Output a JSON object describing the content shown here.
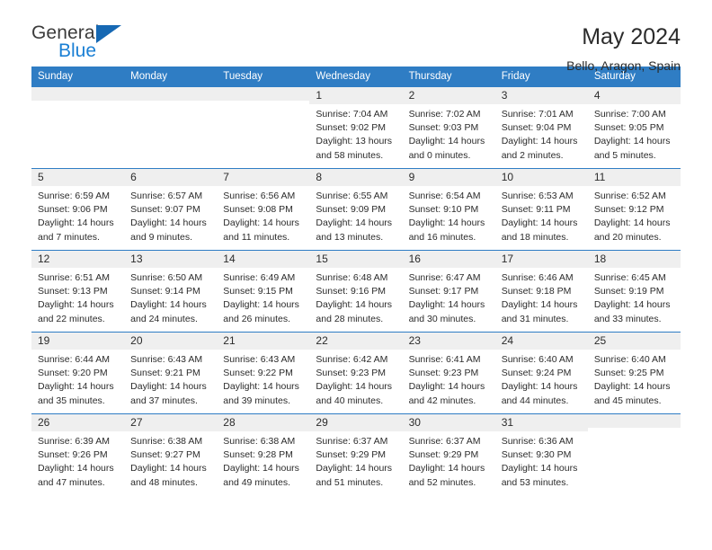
{
  "brand": {
    "name_top": "General",
    "name_bottom": "Blue",
    "accent_color": "#1668b3",
    "blue_text_color": "#1a7fd4"
  },
  "header": {
    "title": "May 2024",
    "subtitle": "Bello, Aragon, Spain"
  },
  "theme": {
    "header_row_bg": "#2f7dc4",
    "daynum_band_bg": "#efefef",
    "grid_line": "#2f7dc4",
    "text": "#2b2b2b"
  },
  "weekdays": [
    "Sunday",
    "Monday",
    "Tuesday",
    "Wednesday",
    "Thursday",
    "Friday",
    "Saturday"
  ],
  "labels": {
    "sunrise_prefix": "Sunrise: ",
    "sunset_prefix": "Sunset: ",
    "daylight_prefix": "Daylight: "
  },
  "weeks": [
    [
      {
        "day": "",
        "empty": true
      },
      {
        "day": "",
        "empty": true
      },
      {
        "day": "",
        "empty": true
      },
      {
        "day": "1",
        "sunrise": "Sunrise: 7:04 AM",
        "sunset": "Sunset: 9:02 PM",
        "daylight": "Daylight: 13 hours and 58 minutes."
      },
      {
        "day": "2",
        "sunrise": "Sunrise: 7:02 AM",
        "sunset": "Sunset: 9:03 PM",
        "daylight": "Daylight: 14 hours and 0 minutes."
      },
      {
        "day": "3",
        "sunrise": "Sunrise: 7:01 AM",
        "sunset": "Sunset: 9:04 PM",
        "daylight": "Daylight: 14 hours and 2 minutes."
      },
      {
        "day": "4",
        "sunrise": "Sunrise: 7:00 AM",
        "sunset": "Sunset: 9:05 PM",
        "daylight": "Daylight: 14 hours and 5 minutes."
      }
    ],
    [
      {
        "day": "5",
        "sunrise": "Sunrise: 6:59 AM",
        "sunset": "Sunset: 9:06 PM",
        "daylight": "Daylight: 14 hours and 7 minutes."
      },
      {
        "day": "6",
        "sunrise": "Sunrise: 6:57 AM",
        "sunset": "Sunset: 9:07 PM",
        "daylight": "Daylight: 14 hours and 9 minutes."
      },
      {
        "day": "7",
        "sunrise": "Sunrise: 6:56 AM",
        "sunset": "Sunset: 9:08 PM",
        "daylight": "Daylight: 14 hours and 11 minutes."
      },
      {
        "day": "8",
        "sunrise": "Sunrise: 6:55 AM",
        "sunset": "Sunset: 9:09 PM",
        "daylight": "Daylight: 14 hours and 13 minutes."
      },
      {
        "day": "9",
        "sunrise": "Sunrise: 6:54 AM",
        "sunset": "Sunset: 9:10 PM",
        "daylight": "Daylight: 14 hours and 16 minutes."
      },
      {
        "day": "10",
        "sunrise": "Sunrise: 6:53 AM",
        "sunset": "Sunset: 9:11 PM",
        "daylight": "Daylight: 14 hours and 18 minutes."
      },
      {
        "day": "11",
        "sunrise": "Sunrise: 6:52 AM",
        "sunset": "Sunset: 9:12 PM",
        "daylight": "Daylight: 14 hours and 20 minutes."
      }
    ],
    [
      {
        "day": "12",
        "sunrise": "Sunrise: 6:51 AM",
        "sunset": "Sunset: 9:13 PM",
        "daylight": "Daylight: 14 hours and 22 minutes."
      },
      {
        "day": "13",
        "sunrise": "Sunrise: 6:50 AM",
        "sunset": "Sunset: 9:14 PM",
        "daylight": "Daylight: 14 hours and 24 minutes."
      },
      {
        "day": "14",
        "sunrise": "Sunrise: 6:49 AM",
        "sunset": "Sunset: 9:15 PM",
        "daylight": "Daylight: 14 hours and 26 minutes."
      },
      {
        "day": "15",
        "sunrise": "Sunrise: 6:48 AM",
        "sunset": "Sunset: 9:16 PM",
        "daylight": "Daylight: 14 hours and 28 minutes."
      },
      {
        "day": "16",
        "sunrise": "Sunrise: 6:47 AM",
        "sunset": "Sunset: 9:17 PM",
        "daylight": "Daylight: 14 hours and 30 minutes."
      },
      {
        "day": "17",
        "sunrise": "Sunrise: 6:46 AM",
        "sunset": "Sunset: 9:18 PM",
        "daylight": "Daylight: 14 hours and 31 minutes."
      },
      {
        "day": "18",
        "sunrise": "Sunrise: 6:45 AM",
        "sunset": "Sunset: 9:19 PM",
        "daylight": "Daylight: 14 hours and 33 minutes."
      }
    ],
    [
      {
        "day": "19",
        "sunrise": "Sunrise: 6:44 AM",
        "sunset": "Sunset: 9:20 PM",
        "daylight": "Daylight: 14 hours and 35 minutes."
      },
      {
        "day": "20",
        "sunrise": "Sunrise: 6:43 AM",
        "sunset": "Sunset: 9:21 PM",
        "daylight": "Daylight: 14 hours and 37 minutes."
      },
      {
        "day": "21",
        "sunrise": "Sunrise: 6:43 AM",
        "sunset": "Sunset: 9:22 PM",
        "daylight": "Daylight: 14 hours and 39 minutes."
      },
      {
        "day": "22",
        "sunrise": "Sunrise: 6:42 AM",
        "sunset": "Sunset: 9:23 PM",
        "daylight": "Daylight: 14 hours and 40 minutes."
      },
      {
        "day": "23",
        "sunrise": "Sunrise: 6:41 AM",
        "sunset": "Sunset: 9:23 PM",
        "daylight": "Daylight: 14 hours and 42 minutes."
      },
      {
        "day": "24",
        "sunrise": "Sunrise: 6:40 AM",
        "sunset": "Sunset: 9:24 PM",
        "daylight": "Daylight: 14 hours and 44 minutes."
      },
      {
        "day": "25",
        "sunrise": "Sunrise: 6:40 AM",
        "sunset": "Sunset: 9:25 PM",
        "daylight": "Daylight: 14 hours and 45 minutes."
      }
    ],
    [
      {
        "day": "26",
        "sunrise": "Sunrise: 6:39 AM",
        "sunset": "Sunset: 9:26 PM",
        "daylight": "Daylight: 14 hours and 47 minutes."
      },
      {
        "day": "27",
        "sunrise": "Sunrise: 6:38 AM",
        "sunset": "Sunset: 9:27 PM",
        "daylight": "Daylight: 14 hours and 48 minutes."
      },
      {
        "day": "28",
        "sunrise": "Sunrise: 6:38 AM",
        "sunset": "Sunset: 9:28 PM",
        "daylight": "Daylight: 14 hours and 49 minutes."
      },
      {
        "day": "29",
        "sunrise": "Sunrise: 6:37 AM",
        "sunset": "Sunset: 9:29 PM",
        "daylight": "Daylight: 14 hours and 51 minutes."
      },
      {
        "day": "30",
        "sunrise": "Sunrise: 6:37 AM",
        "sunset": "Sunset: 9:29 PM",
        "daylight": "Daylight: 14 hours and 52 minutes."
      },
      {
        "day": "31",
        "sunrise": "Sunrise: 6:36 AM",
        "sunset": "Sunset: 9:30 PM",
        "daylight": "Daylight: 14 hours and 53 minutes."
      },
      {
        "day": "",
        "empty": true
      }
    ]
  ]
}
